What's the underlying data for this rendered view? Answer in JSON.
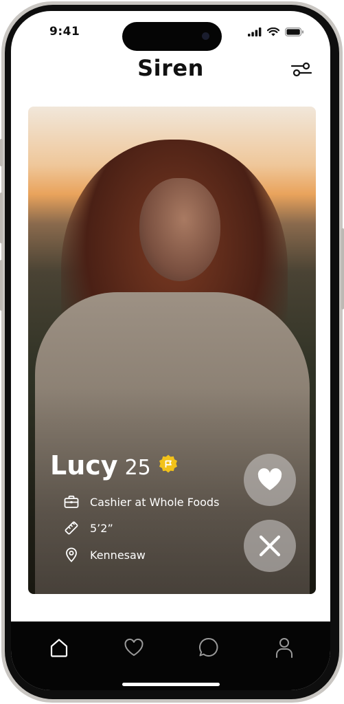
{
  "status": {
    "time": "9:41"
  },
  "header": {
    "title": "Siren",
    "filter_icon": "filter-sliders-icon"
  },
  "profile": {
    "name": "Lucy",
    "age": "25",
    "verified_icon": "verified-badge-icon",
    "details": [
      {
        "icon": "briefcase-icon",
        "text": "Cashier at Whole Foods"
      },
      {
        "icon": "ruler-icon",
        "text": "5’2”"
      },
      {
        "icon": "location-pin-icon",
        "text": "Kennesaw"
      }
    ]
  },
  "actions": {
    "like_icon": "heart-icon",
    "dislike_icon": "close-icon"
  },
  "tabs": [
    {
      "id": "home",
      "icon": "home-icon",
      "active": true
    },
    {
      "id": "likes",
      "icon": "heart-outline-icon",
      "active": false
    },
    {
      "id": "messages",
      "icon": "chat-bubble-icon",
      "active": false
    },
    {
      "id": "profile",
      "icon": "user-icon",
      "active": false
    }
  ],
  "colors": {
    "accent": "#f2c21a",
    "tab_bar": "#050505",
    "text": "#111111"
  }
}
